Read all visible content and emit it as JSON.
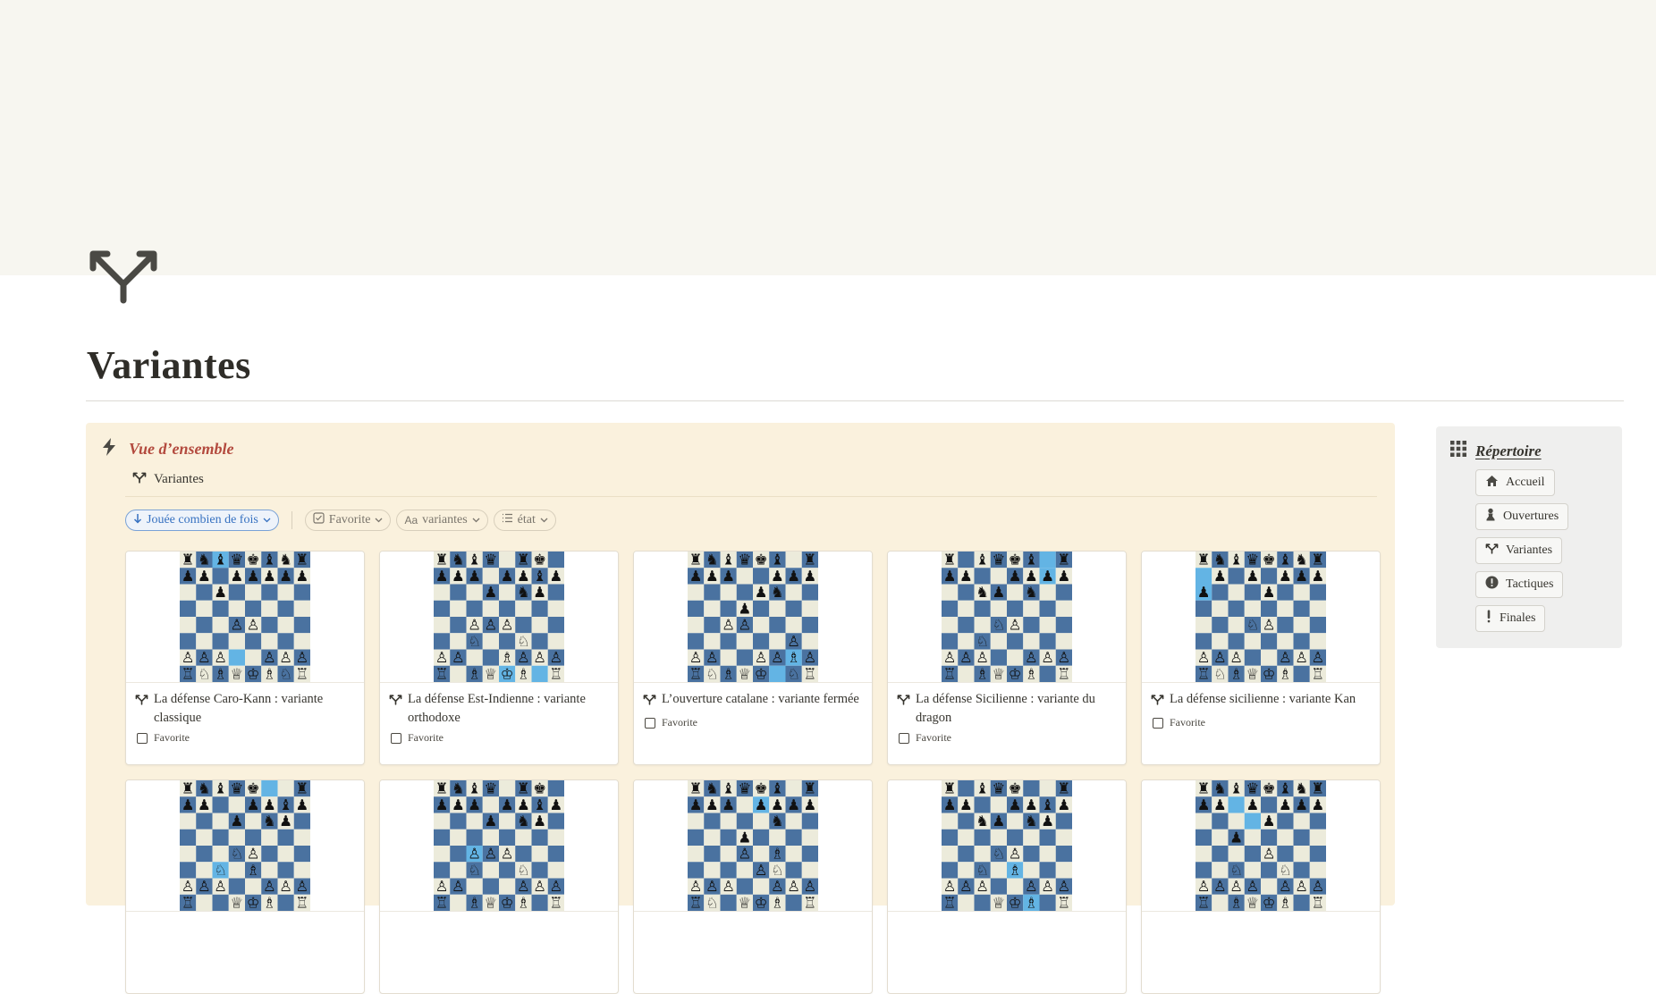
{
  "page": {
    "title": "Variantes",
    "icon": "fork-arrows-icon"
  },
  "overview": {
    "heading": "Vue d’ensemble",
    "heading_icon": "lightning-icon",
    "database_title": "Variantes",
    "filters": {
      "sort_label": "Jouée combien de fois",
      "favorite_label": "Favorite",
      "name_label": "variantes",
      "status_label": "état"
    },
    "cards": [
      {
        "title": "La défense Caro-Kann : variante classique",
        "favorite_label": "Favorite"
      },
      {
        "title": "La défense Est-Indienne : variante orthodoxe",
        "favorite_label": "Favorite"
      },
      {
        "title": "L’ouverture catalane : variante fermée",
        "favorite_label": "Favorite"
      },
      {
        "title": "La défense Sicilienne : variante du dragon",
        "favorite_label": "Favorite"
      },
      {
        "title": "La défense sicilienne : variante Kan",
        "favorite_label": "Favorite"
      },
      {
        "title": "",
        "favorite_label": ""
      },
      {
        "title": "",
        "favorite_label": ""
      },
      {
        "title": "",
        "favorite_label": ""
      },
      {
        "title": "",
        "favorite_label": ""
      },
      {
        "title": "",
        "favorite_label": ""
      }
    ]
  },
  "sidebar": {
    "title": "Répertoire",
    "title_icon": "grid-icon",
    "items": [
      {
        "label": "Accueil",
        "icon": "home-icon"
      },
      {
        "label": "Ouvertures",
        "icon": "pawn-icon"
      },
      {
        "label": "Variantes",
        "icon": "fork-arrows-icon"
      },
      {
        "label": "Tactiques",
        "icon": "exclamation-circle-icon"
      },
      {
        "label": "Finales",
        "icon": "exclamation-icon"
      }
    ]
  },
  "colors": {
    "cover": "#f7f6f0",
    "panel": "#faf1dd",
    "accent_red": "#b34a3e",
    "board_dark": "#4a72a0",
    "board_light": "#ecebdb",
    "board_highlight": "#63b4e4",
    "sort_blue": "#3570c0",
    "sidebar_bg": "#efefee"
  },
  "boards": [
    {
      "ranks": [
        "rnbqkbnr",
        "pp1ppppp",
        "2p5",
        "8",
        "3PP3",
        "8",
        "PPP2PPP",
        "RNBQKBNR"
      ],
      "hl": [
        "c8",
        "d2"
      ]
    },
    {
      "ranks": [
        "rnbq1rk1",
        "ppp1ppbp",
        "3p1np1",
        "8",
        "2PPP3",
        "2N2N2",
        "PP2BPPP",
        "R1BQKB1R"
      ],
      "hl": [
        "g1",
        "e1"
      ]
    },
    {
      "ranks": [
        "rnbqkb1r",
        "ppp2ppp",
        "4pn2",
        "3p4",
        "2PP4",
        "6P1",
        "PP2PPBP",
        "RNBQK1NR"
      ],
      "hl": [
        "f1",
        "g2"
      ]
    },
    {
      "ranks": [
        "r1bqkb1r",
        "pp2pppp",
        "2np1n2",
        "8",
        "3NP3",
        "2N5",
        "PPP2PPP",
        "R1BQKB1R"
      ],
      "hl": [
        "g7",
        "g8"
      ]
    },
    {
      "ranks": [
        "rnbqkbnr",
        "1p1p1ppp",
        "p3p3",
        "8",
        "3NP3",
        "8",
        "PPP2PPP",
        "RNBQKB1R"
      ],
      "hl": [
        "a7",
        "a6"
      ]
    },
    {
      "ranks": [
        "rnbqk2r",
        "pp2ppbp",
        "3p1np1",
        "8",
        "3NP3",
        "2N1B3",
        "PPP2PPP",
        "R2QKB1R"
      ],
      "hl": [
        "f8",
        "c3"
      ]
    },
    {
      "ranks": [
        "rnbq1rk1",
        "ppp1ppbp",
        "3p1np1",
        "8",
        "2PPP3",
        "2N2N2",
        "PP3PPP",
        "R1BQKB1R"
      ],
      "hl": [
        "c4"
      ]
    },
    {
      "ranks": [
        "rnbqkb1r",
        "ppp1pppp",
        "5n2",
        "3p4",
        "3P1B2",
        "4PN2",
        "PPP2PPP",
        "RN1QKB1R"
      ],
      "hl": [
        "e7"
      ]
    },
    {
      "ranks": [
        "r1bqk2r",
        "pp2ppbp",
        "2np1np1",
        "8",
        "3NP3",
        "2N1B3",
        "PPP2PPP",
        "R2QKB1R"
      ],
      "hl": [
        "e3",
        "f1"
      ]
    },
    {
      "ranks": [
        "rnbqkbnr",
        "pp1p1ppp",
        "4p3",
        "2p5",
        "4P3",
        "2N2N2",
        "PPPP1PPP",
        "R1BQKB1R"
      ],
      "hl": [
        "d6",
        "c7"
      ]
    }
  ]
}
